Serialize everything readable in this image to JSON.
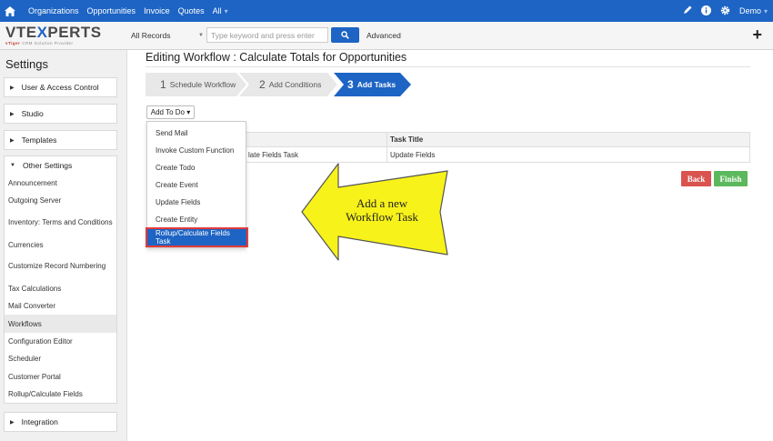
{
  "topnav": {
    "items": [
      "Organizations",
      "Opportunities",
      "Invoice",
      "Quotes",
      "All"
    ],
    "user": "Demo"
  },
  "header": {
    "logo_main_left": "VTE",
    "logo_main_x": "X",
    "logo_main_right": "PERTS",
    "logo_sub_brand": "vTiger",
    "logo_sub_rest": " CRM Solution Provider",
    "records_select": "All Records",
    "search_placeholder": "Type keyword and press enter",
    "advanced": "Advanced"
  },
  "sidebar": {
    "title": "Settings",
    "sections": [
      "User & Access Control",
      "Studio",
      "Templates",
      "Other Settings",
      "Integration"
    ],
    "items": [
      "Announcement",
      "Outgoing Server",
      "Inventory: Terms and Conditions",
      "Currencies",
      "Customize Record Numbering",
      "Tax Calculations",
      "Mail Converter",
      "Workflows",
      "Configuration Editor",
      "Scheduler",
      "Customer Portal",
      "Rollup/Calculate Fields"
    ]
  },
  "main": {
    "title": "Editing Workflow : Calculate Totals for Opportunities",
    "steps": [
      {
        "num": "1",
        "label": "Schedule Workflow"
      },
      {
        "num": "2",
        "label": "Add Conditions"
      },
      {
        "num": "3",
        "label": "Add Tasks"
      }
    ],
    "add_todo": "Add To Do ▾",
    "dropdown": [
      "Send Mail",
      "Invoke Custom Function",
      "Create Todo",
      "Create Event",
      "Update Fields",
      "Create Entity",
      "Rollup/Calculate Fields Task"
    ],
    "table": {
      "col2_header": "Task Title",
      "row_col1": "late Fields Task",
      "row_col2": "Update Fields"
    },
    "back": "Back",
    "finish": "Finish",
    "callout_line1": "Add a new",
    "callout_line2": "Workflow Task"
  },
  "colors": {
    "nav_blue": "#1d64c4",
    "back_red": "#d9534f",
    "finish_green": "#5cb85c",
    "callout_yellow": "#f7f21a"
  }
}
